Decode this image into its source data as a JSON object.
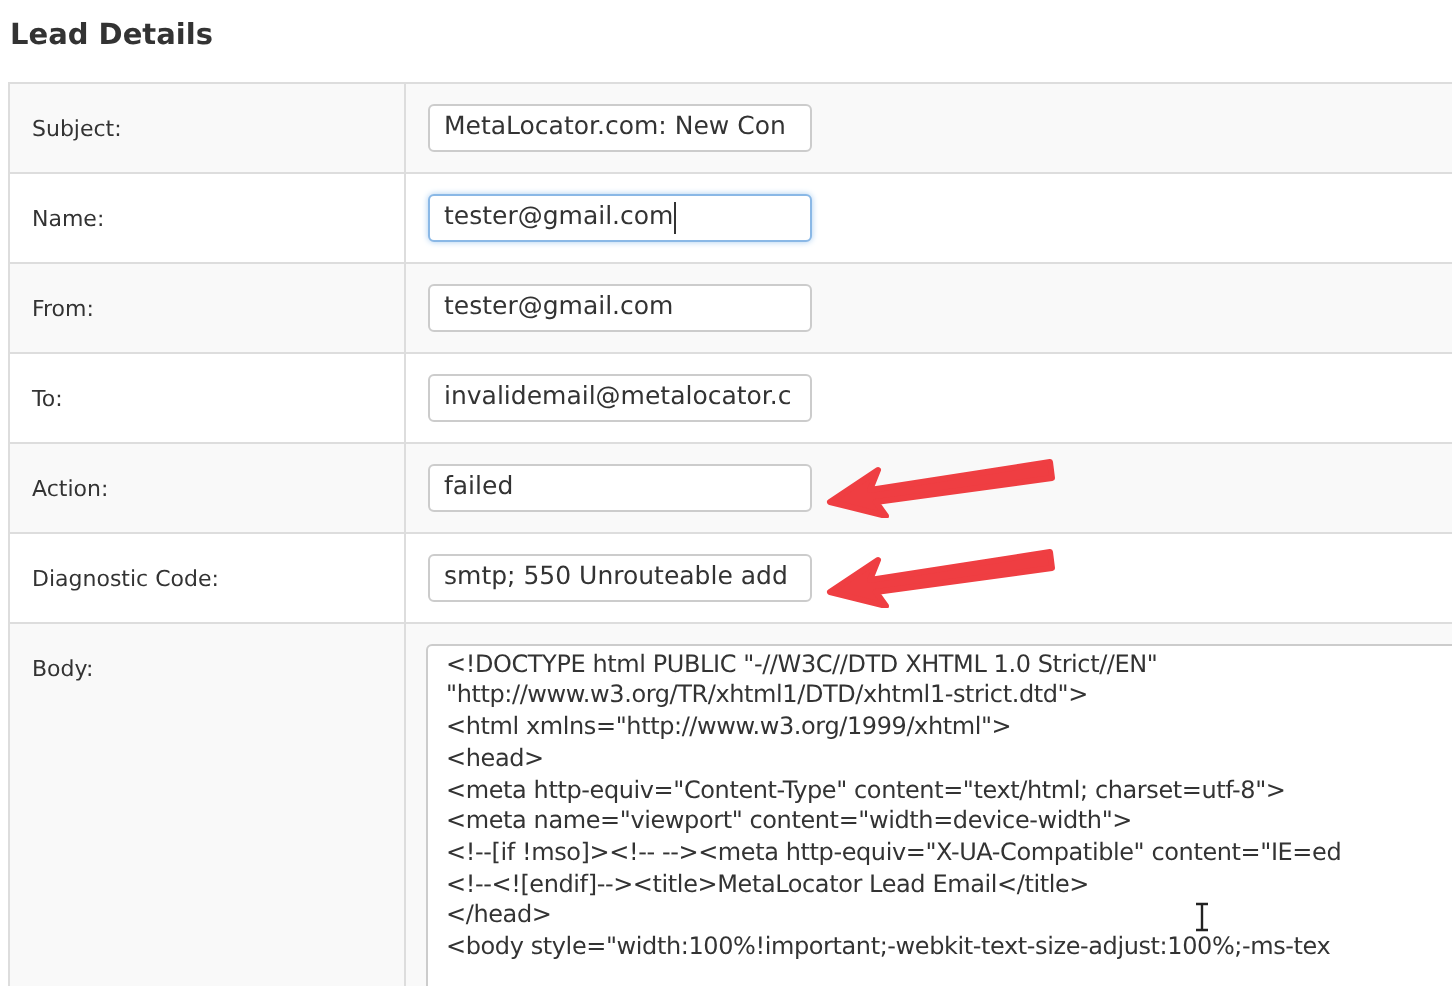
{
  "title": "Lead Details",
  "fields": [
    {
      "label": "Subject:",
      "value": "MetaLocator.com: New Con",
      "focused": false,
      "highlighted": false
    },
    {
      "label": "Name:",
      "value": "tester@gmail.com",
      "focused": true,
      "highlighted": false
    },
    {
      "label": "From:",
      "value": "tester@gmail.com",
      "focused": false,
      "highlighted": false
    },
    {
      "label": "To:",
      "value": "invalidemail@metalocator.c",
      "focused": false,
      "highlighted": false
    },
    {
      "label": "Action:",
      "value": "failed",
      "focused": false,
      "highlighted": true
    },
    {
      "label": "Diagnostic Code:",
      "value": "smtp; 550 Unrouteable add",
      "focused": false,
      "highlighted": true
    }
  ],
  "body": {
    "label": "Body:",
    "lines": [
      "<!DOCTYPE html PUBLIC \"-//W3C//DTD XHTML 1.0 Strict//EN\"",
      "\"http://www.w3.org/TR/xhtml1/DTD/xhtml1-strict.dtd\">",
      "<html xmlns=\"http://www.w3.org/1999/xhtml\">",
      "<head>",
      "<meta http-equiv=\"Content-Type\" content=\"text/html; charset=utf-8\">",
      "<meta name=\"viewport\" content=\"width=device-width\">",
      "<!--[if !mso]><!-- --><meta http-equiv=\"X-UA-Compatible\" content=\"IE=ed",
      "<!--<![endif]--><title>MetaLocator Lead Email</title>",
      "</head>",
      "<body style=\"width:100%!important;-webkit-text-size-adjust:100%;-ms-tex"
    ]
  }
}
